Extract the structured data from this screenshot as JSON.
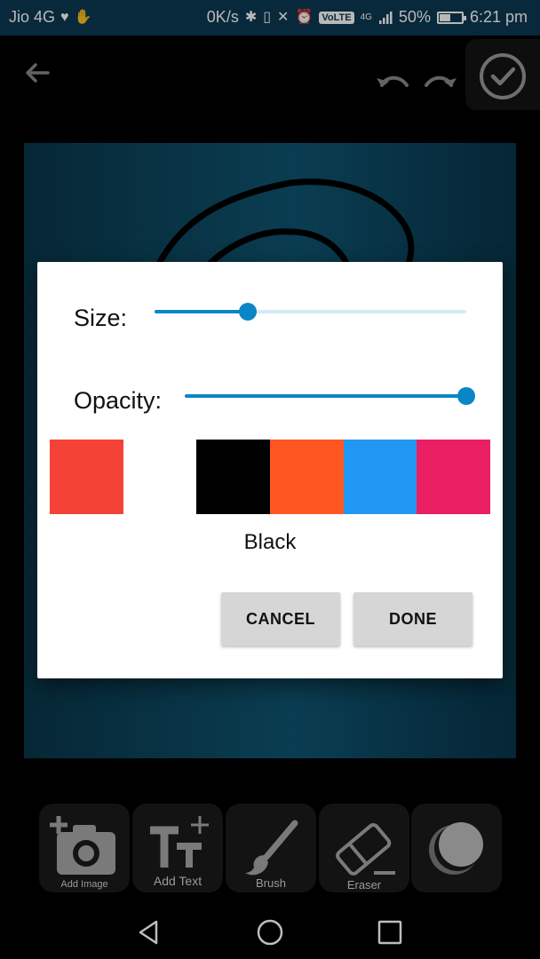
{
  "status_bar": {
    "carrier": "Jio 4G",
    "net_speed": "0K/s",
    "volte": "VoLTE",
    "network": "4G",
    "battery": "50%",
    "time": "6:21 pm"
  },
  "dialog": {
    "size_label": "Size:",
    "size_value": 0.3,
    "opacity_label": "Opacity:",
    "opacity_value": 1.0,
    "colors": [
      "#f44336",
      "#ffffff",
      "#000000",
      "#ff5722",
      "#2196f3",
      "#e91e63"
    ],
    "selected_color_name": "Black",
    "cancel_label": "CANCEL",
    "done_label": "DONE"
  },
  "toolbar": {
    "add_image": "Add Image",
    "add_text": "Add Text",
    "brush": "Brush",
    "eraser": "Eraser"
  },
  "theme": {
    "accent": "#0a86c8",
    "status_bar": "#0c3a52"
  }
}
